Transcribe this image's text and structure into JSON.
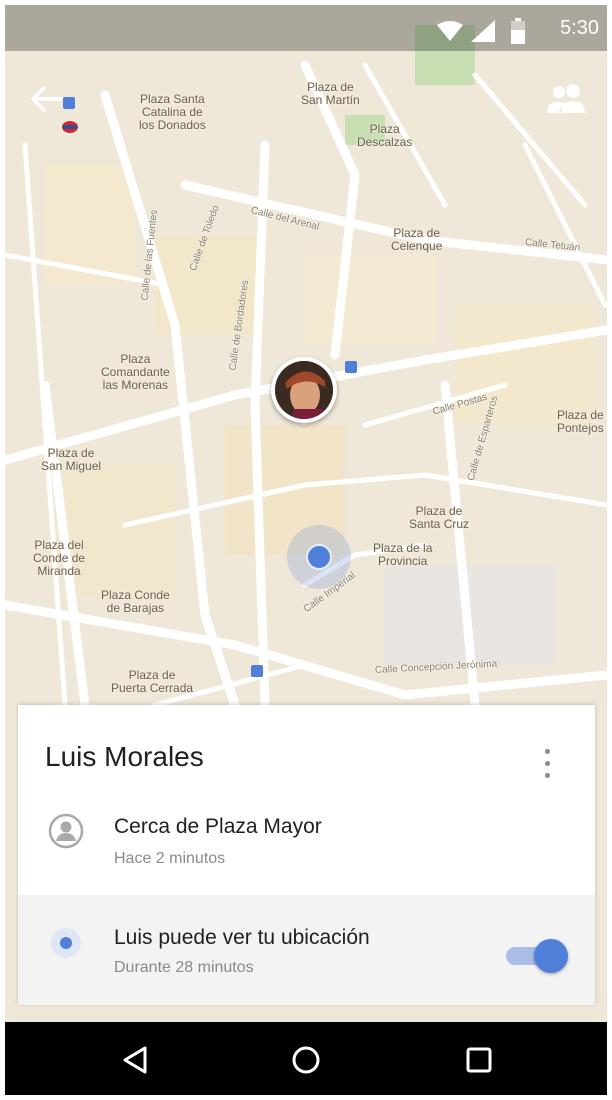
{
  "status_bar": {
    "time": "5:30",
    "icons": [
      "wifi-icon",
      "signal-icon",
      "battery-icon"
    ]
  },
  "toolbar": {
    "back_icon": "arrow-back-icon",
    "people_icon": "people-icon"
  },
  "map": {
    "place_labels": [
      "Plaza de\nSan Martín",
      "Plaza Santa\nCatalina de\nlos Donados",
      "Plaza\nDescalzas",
      "Plaza de\nCelenque",
      "Plaza\nComandante\nlas Morenas",
      "Plaza de\nPontejos",
      "Plaza de\nSan Miguel",
      "Plaza de\nSanta Cruz",
      "Plaza del\nConde de\nMiranda",
      "Plaza de la\nProvincia",
      "Plaza Conde\nde Barajas",
      "Plaza de\nPuerta Cerrada"
    ],
    "street_labels": [
      "Calle del Arenal",
      "Calle Tetuán",
      "Calle Postas",
      "Calle Concepción Jerónima",
      "Calle de Toledo",
      "Calle Imperial",
      "Calle de Esparteros",
      "Calle de las Fuentes",
      "Calle de Bordadores"
    ]
  },
  "card": {
    "title": "Luis Morales",
    "menu_icon": "more-vert-icon",
    "location": {
      "icon": "person-icon",
      "primary": "Cerca de Plaza Mayor",
      "secondary": "Hace 2 minutos"
    },
    "sharing": {
      "icon": "my-location-icon",
      "primary": "Luis puede ver tu ubicación",
      "secondary": "Durante 28 minutos",
      "toggle_on": true
    }
  },
  "nav_bar": {
    "icons": [
      "back-triangle-icon",
      "home-circle-icon",
      "recents-square-icon"
    ]
  },
  "colors": {
    "accent": "#4f7fd8",
    "map_background": "#efe9dc",
    "map_streets": "#ffffff"
  }
}
